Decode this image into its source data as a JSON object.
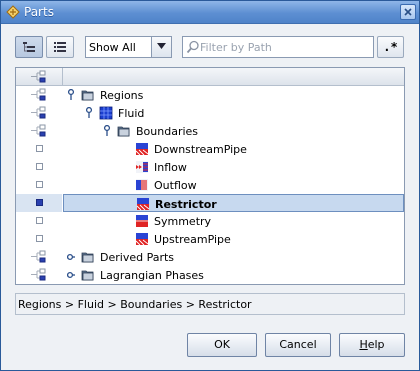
{
  "window": {
    "title": "Parts"
  },
  "toolbar": {
    "show_options": [
      "Show All"
    ],
    "show_selected": "Show All",
    "filter_placeholder": "Filter by Path",
    "regex_label": ".*"
  },
  "tree": {
    "rows": [
      {
        "label": "Regions",
        "visibility": "partial",
        "expander": "expanded",
        "icon": "folder-icon",
        "level": 0
      },
      {
        "label": "Fluid",
        "visibility": "partial",
        "expander": "expanded",
        "icon": "region-icon",
        "level": 1
      },
      {
        "label": "Boundaries",
        "visibility": "partial",
        "expander": "expanded",
        "icon": "folder-icon",
        "level": 2
      },
      {
        "label": "DownstreamPipe",
        "visibility": "off",
        "expander": "none",
        "icon": "boundary-wall-icon",
        "level": 3
      },
      {
        "label": "Inflow",
        "visibility": "off",
        "expander": "none",
        "icon": "boundary-inlet-icon",
        "level": 3
      },
      {
        "label": "Outflow",
        "visibility": "off",
        "expander": "none",
        "icon": "boundary-outlet-icon",
        "level": 3
      },
      {
        "label": "Restrictor",
        "visibility": "on",
        "expander": "none",
        "icon": "boundary-wall-icon",
        "level": 3,
        "selected": true
      },
      {
        "label": "Symmetry",
        "visibility": "off",
        "expander": "none",
        "icon": "boundary-symmetry-icon",
        "level": 3
      },
      {
        "label": "UpstreamPipe",
        "visibility": "off",
        "expander": "none",
        "icon": "boundary-wall-icon",
        "level": 3
      },
      {
        "label": "Derived Parts",
        "visibility": "partial",
        "expander": "collapsed",
        "icon": "folder-icon",
        "level": 0
      },
      {
        "label": "Lagrangian Phases",
        "visibility": "partial",
        "expander": "collapsed",
        "icon": "folder-icon",
        "level": 0
      }
    ]
  },
  "breadcrumb": "Regions > Fluid > Boundaries > Restrictor",
  "buttons": {
    "ok": "OK",
    "cancel": "Cancel",
    "help_pre": "",
    "help_mnemonic": "H",
    "help_post": "elp"
  }
}
